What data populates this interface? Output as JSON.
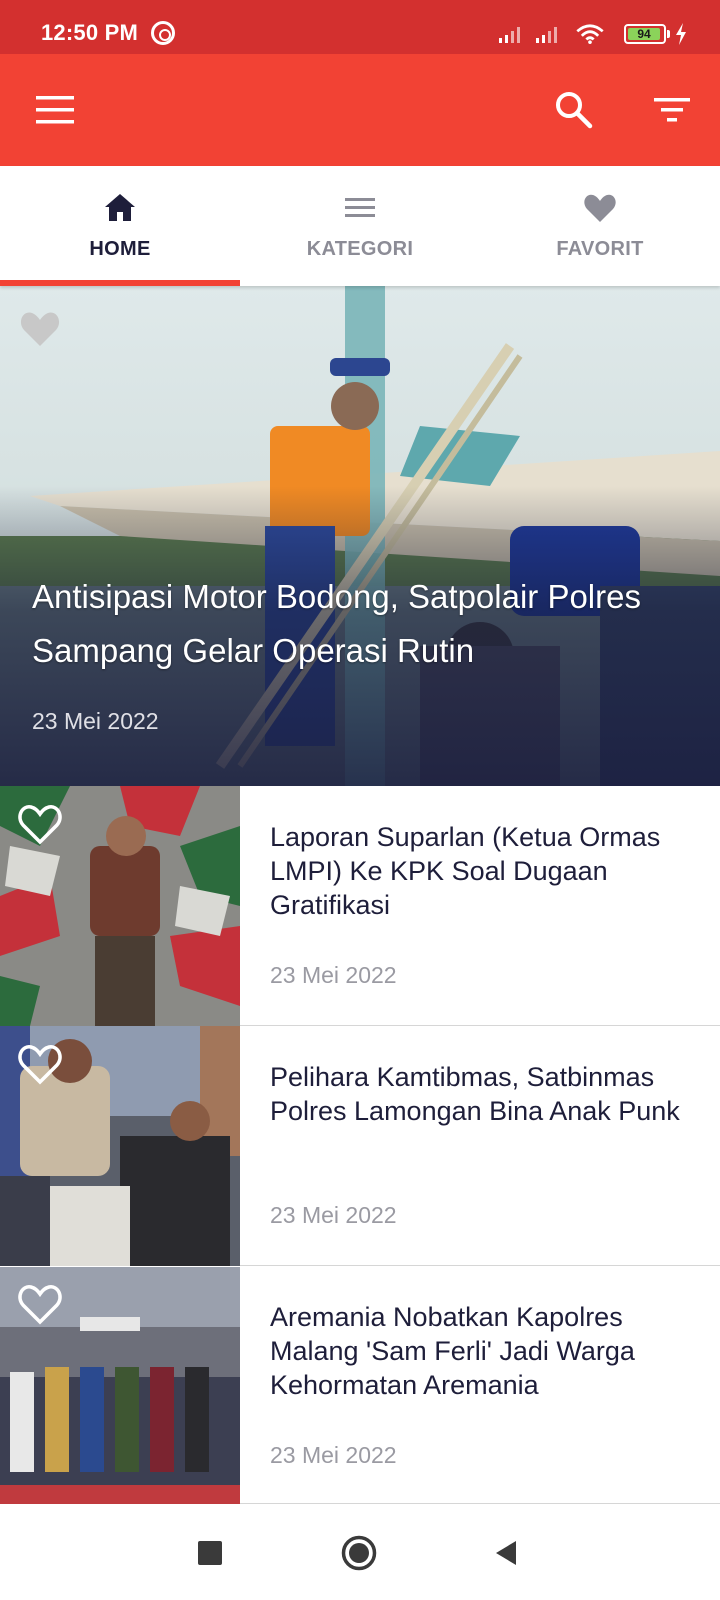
{
  "status_bar": {
    "time": "12:50 PM",
    "battery": "94",
    "icons": [
      "sync-icon",
      "signal-icon",
      "signal-icon",
      "wifi-icon",
      "battery-icon",
      "charging-bolt-icon"
    ]
  },
  "app_bar": {
    "menu_icon": "hamburger-menu-icon",
    "search_icon": "search-icon",
    "filter_icon": "filter-icon"
  },
  "tabs": [
    {
      "label": "HOME",
      "icon": "home-icon",
      "active": true
    },
    {
      "label": "KATEGORI",
      "icon": "list-icon",
      "active": false
    },
    {
      "label": "FAVORIT",
      "icon": "heart-icon",
      "active": false
    }
  ],
  "featured": {
    "title": "Antisipasi Motor Bodong, Satpolair Polres Sampang Gelar Operasi Rutin",
    "date": "23 Mei 2022"
  },
  "news": [
    {
      "title": "Laporan Suparlan (Ketua Ormas LMPI)  Ke KPK Soal Dugaan Gratifikasi",
      "date": "23 Mei 2022"
    },
    {
      "title": "Pelihara Kamtibmas, Satbinmas Polres Lamongan Bina Anak Punk",
      "date": "23 Mei 2022"
    },
    {
      "title": "Aremania Nobatkan Kapolres Malang 'Sam Ferli' Jadi Warga Kehormatan Aremania",
      "date": "23 Mei 2022"
    }
  ],
  "nav_bar": {
    "icons": [
      "recents-square-icon",
      "home-circle-icon",
      "back-triangle-icon"
    ]
  },
  "colors": {
    "status_bar": "#d3302f",
    "app_bar": "#f24234",
    "tab_active": "#1e1e3a",
    "tab_inactive": "#8c8c96",
    "title_text": "#1e1e3a",
    "date_text": "#9a9aa2"
  }
}
